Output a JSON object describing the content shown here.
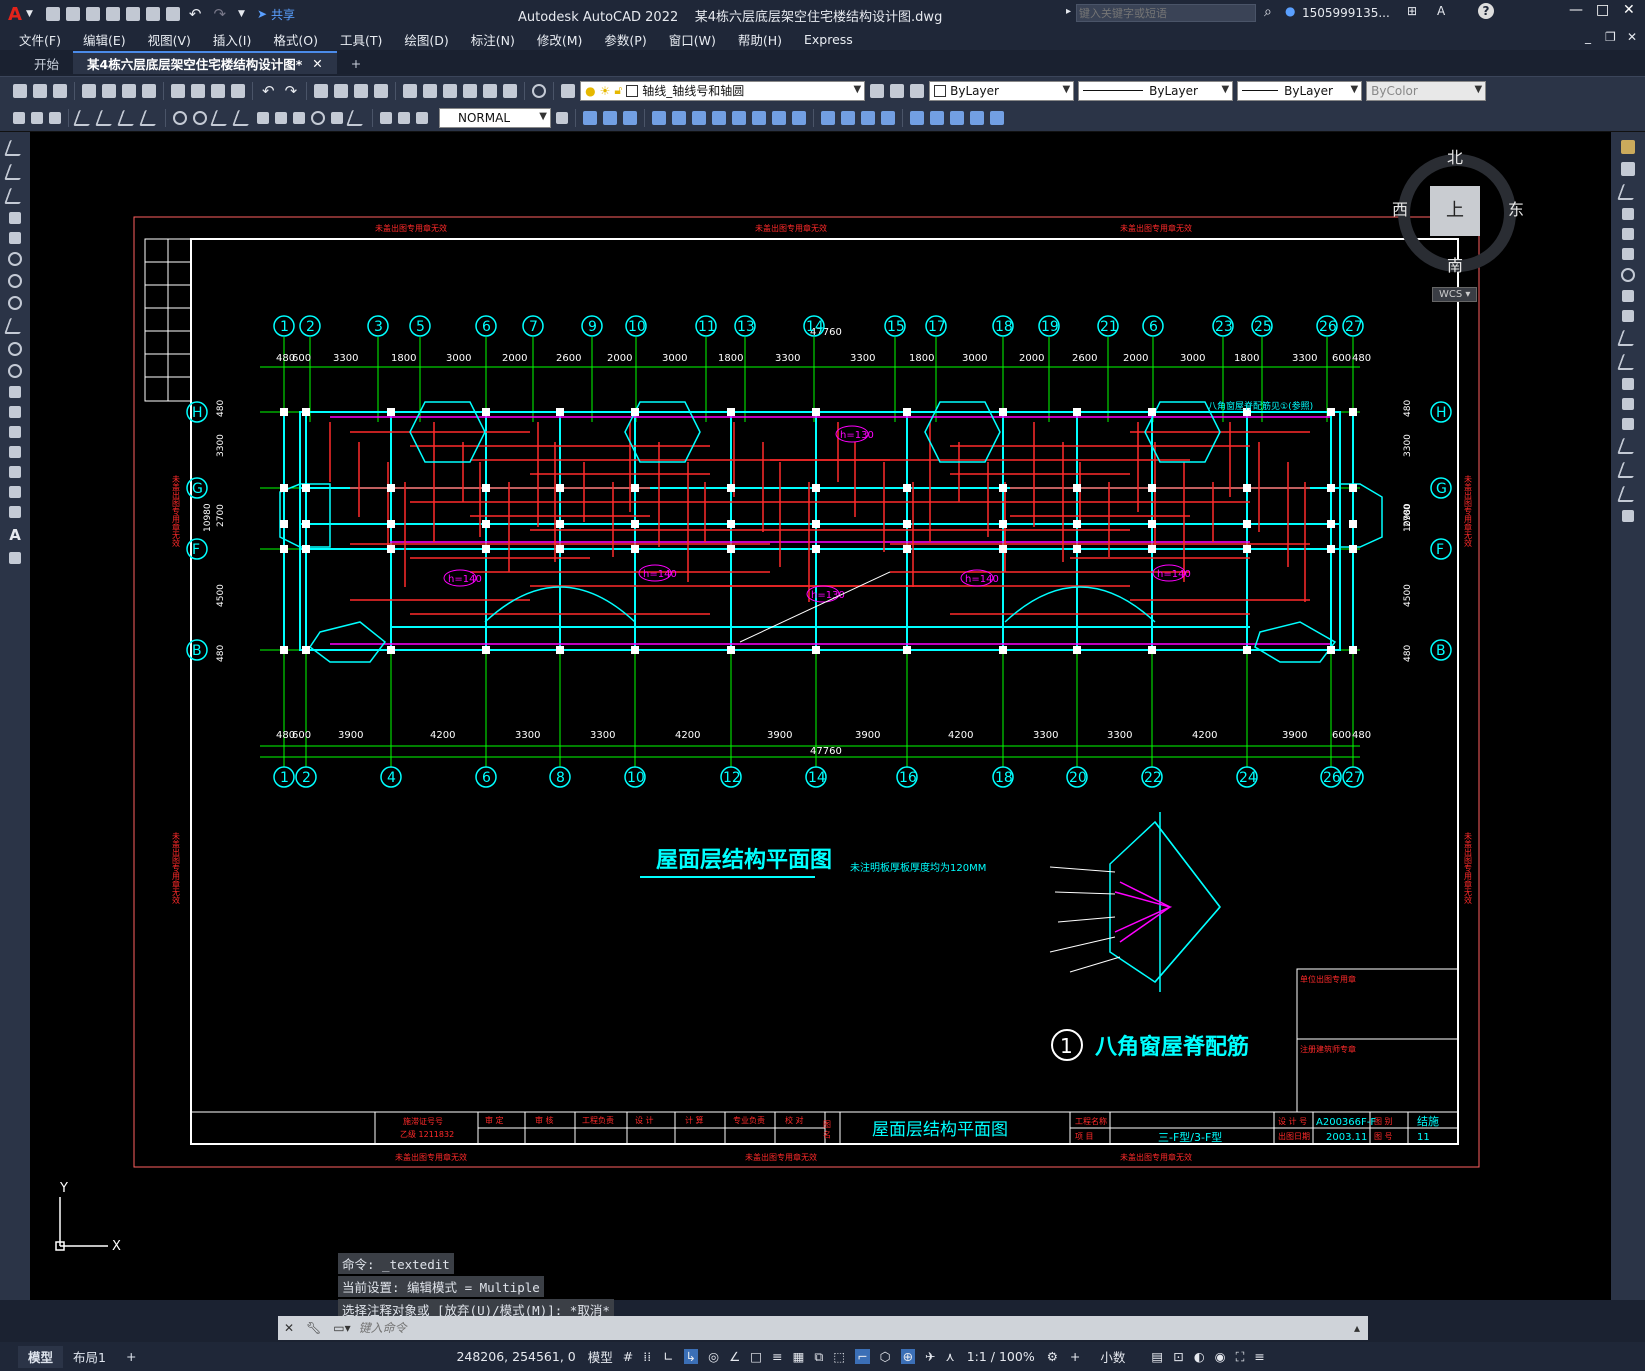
{
  "app": {
    "title": "Autodesk AutoCAD 2022",
    "filename": "某4栋六层底层架空住宅楼结构设计图.dwg",
    "share_label": "共享",
    "search_placeholder": "键入关键字或短语",
    "user": "1505999135...",
    "help_icon": "help-icon"
  },
  "menu": [
    "文件(F)",
    "编辑(E)",
    "视图(V)",
    "插入(I)",
    "格式(O)",
    "工具(T)",
    "绘图(D)",
    "标注(N)",
    "修改(M)",
    "参数(P)",
    "窗口(W)",
    "帮助(H)",
    "Express"
  ],
  "tabs": {
    "start": "开始",
    "active": "某4栋六层底层架空住宅楼结构设计图*",
    "add": "+"
  },
  "properties": {
    "layer": "轴线_轴线号和轴圆",
    "color": "ByLayer",
    "linetype": "ByLayer",
    "lineweight": "ByLayer",
    "plotstyle": "ByColor",
    "style": "NORMAL"
  },
  "viewcube": {
    "north": "北",
    "south": "南",
    "east": "东",
    "west": "西",
    "top": "上",
    "ucs": "WCS"
  },
  "drawing": {
    "title": "屋面层结构平面图",
    "note": "未注明板厚板厚度均为120MM",
    "detail_number": "1",
    "detail_title": "八角窗屋脊配筋",
    "border_note": "未盖出图专用章无效",
    "side_note": "未盖出图专用章无效",
    "top_dim_total": "47760",
    "bottom_dim_total": "47760",
    "top_axes": [
      "1",
      "2",
      "3",
      "5",
      "6",
      "7",
      "9",
      "10",
      "11",
      "13",
      "14",
      "15",
      "17",
      "18",
      "19",
      "21",
      "6",
      "23",
      "25",
      "26",
      "27"
    ],
    "bottom_axes": [
      "1",
      "2",
      "4",
      "6",
      "8",
      "10",
      "12",
      "14",
      "16",
      "18",
      "20",
      "22",
      "24",
      "26",
      "27"
    ],
    "row_axes": [
      "H",
      "G",
      "F",
      "B"
    ],
    "top_dims": [
      "480",
      "600",
      "3300",
      "1800",
      "3000",
      "2000",
      "2600",
      "2000",
      "3000",
      "1800",
      "3300",
      "3300",
      "1800",
      "3000",
      "2000",
      "2600",
      "2000",
      "3000",
      "1800",
      "3300",
      "600",
      "480"
    ],
    "bottom_dims": [
      "480",
      "600",
      "3900",
      "4200",
      "3300",
      "3300",
      "4200",
      "3900",
      "3900",
      "4200",
      "3300",
      "3300",
      "4200",
      "3900",
      "600",
      "480"
    ],
    "left_dims": [
      "480",
      "3300",
      "2700",
      "4500",
      "480"
    ],
    "left_total": "10980",
    "slab_labels": [
      "h=130",
      "h=140",
      "h=140",
      "h=130",
      "h=140",
      "h=140"
    ],
    "ridge_label": "八角窗屋脊配筋见①(参照)",
    "titleblock": {
      "cert_label": "施滞证号号",
      "cert_value": "乙级 1211832",
      "cells": [
        "审 定",
        "审 核",
        "工程负责",
        "设 计",
        "计 算",
        "专业负责",
        "校 对",
        "图 名"
      ],
      "drawing_name": "屋面层结构平面图",
      "project_label": "工程名称",
      "item_label": "项 目",
      "type_value": "三-F型/3-F型",
      "design_no_label": "设 计 号",
      "design_no": "A200366F-F",
      "date_label": "出图日期",
      "date": "2003.11",
      "sheet_label": "图 别",
      "sheet_type": "结施",
      "sheet_no_label": "图 号",
      "sheet_no": "11",
      "stamp_label": "单位出图专用章",
      "reg_label": "注册建筑师专章"
    }
  },
  "command": {
    "history": [
      "命令: _textedit",
      "当前设置: 编辑模式 = Multiple",
      "选择注释对象或 [放弃(U)/模式(M)]: *取消*"
    ],
    "placeholder": "键入命令"
  },
  "status": {
    "model_tab": "模型",
    "layout_tab": "布局1",
    "add": "+",
    "coords": "248206, 254561, 0",
    "space": "模型",
    "scale": "1:1 / 100%",
    "units": "小数"
  },
  "colors": {
    "cyan": "#00ffff",
    "green": "#00ff00",
    "red": "#ff2a2a",
    "magenta": "#ff00ff",
    "white": "#ffffff",
    "yellow": "#ffff00"
  }
}
